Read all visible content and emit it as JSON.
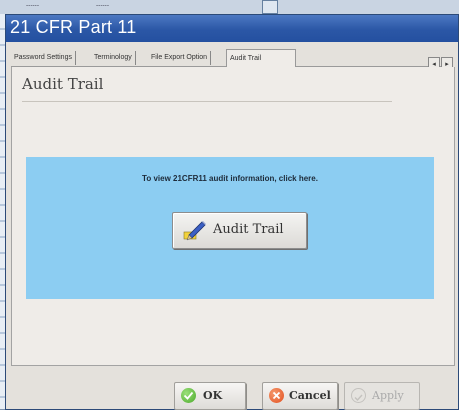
{
  "background": {
    "labels": [
      "------",
      "------"
    ]
  },
  "dialog": {
    "title": "21 CFR Part 11",
    "tabs": [
      {
        "label": "Password Settings"
      },
      {
        "label": "Terminology"
      },
      {
        "label": "File Export Option"
      },
      {
        "label": "Audit Trail",
        "active": true
      }
    ],
    "tab_scroll": {
      "left": "◂",
      "right": "▸"
    },
    "panel": {
      "heading": "Audit Trail",
      "info_text": "To view 21CFR11 audit information, click here.",
      "audit_button_label": "Audit Trail"
    },
    "buttons": {
      "ok": "OK",
      "cancel": "Cancel",
      "apply": "Apply"
    }
  },
  "colors": {
    "title_bar": "#2b57a6",
    "info_box": "#8ccdf2",
    "ok_icon": "#4caa2c",
    "cancel_icon": "#e24f1f"
  }
}
